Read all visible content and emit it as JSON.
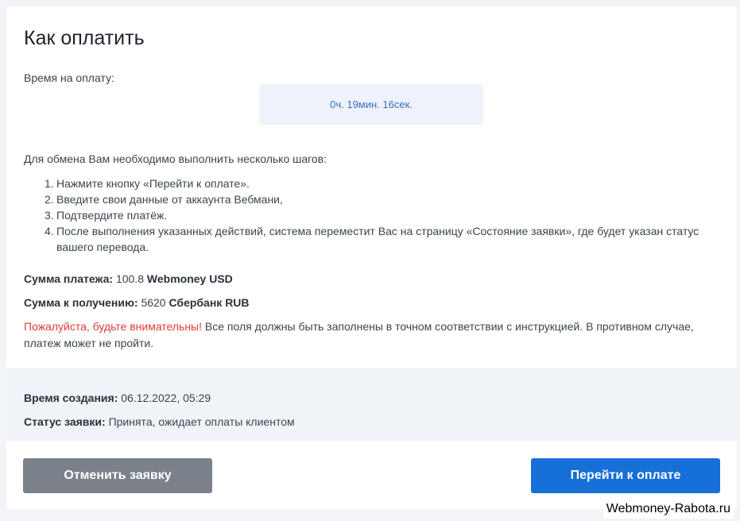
{
  "title": "Как оплатить",
  "time_label": "Время на оплату:",
  "timer": "0ч. 19мин. 16сек.",
  "intro": "Для обмена Вам необходимо выполнить несколько шагов:",
  "steps": [
    {
      "num": "1.",
      "text": "Нажмите кнопку «Перейти к оплате»."
    },
    {
      "num": "2.",
      "text": "Введите свои данные от аккаунта Вебмани,"
    },
    {
      "num": "3.",
      "text": "Подтвердите платёж."
    },
    {
      "num": "4.",
      "text": "После выполнения указанных действий, система переместит Вас на страницу «Состояние заявки», где будет указан статус вашего перевода."
    }
  ],
  "payment_sum": {
    "label": "Сумма платежа:",
    "value": "100.8",
    "currency": "Webmoney USD"
  },
  "receive_sum": {
    "label": "Сумма к получению:",
    "value": "5620",
    "currency": "Сбербанк RUB"
  },
  "warning": {
    "highlight": "Пожалуйста, будьте внимательны!",
    "text": "Все поля должны быть заполнены в точном соответствии с инструкцией. В противном случае, платеж может не пройти."
  },
  "created": {
    "label": "Время создания:",
    "value": "06.12.2022, 05:29"
  },
  "status": {
    "label": "Статус заявки:",
    "value": "Принята, ожидает оплаты клиентом"
  },
  "buttons": {
    "cancel": "Отменить заявку",
    "pay": "Перейти к оплате"
  },
  "watermark": "Webmoney-Rabota.ru",
  "colors": {
    "accent": "#1670d8",
    "cancel": "#7a818b",
    "warning": "#e03a3a",
    "timer_text": "#3b6fc4"
  }
}
